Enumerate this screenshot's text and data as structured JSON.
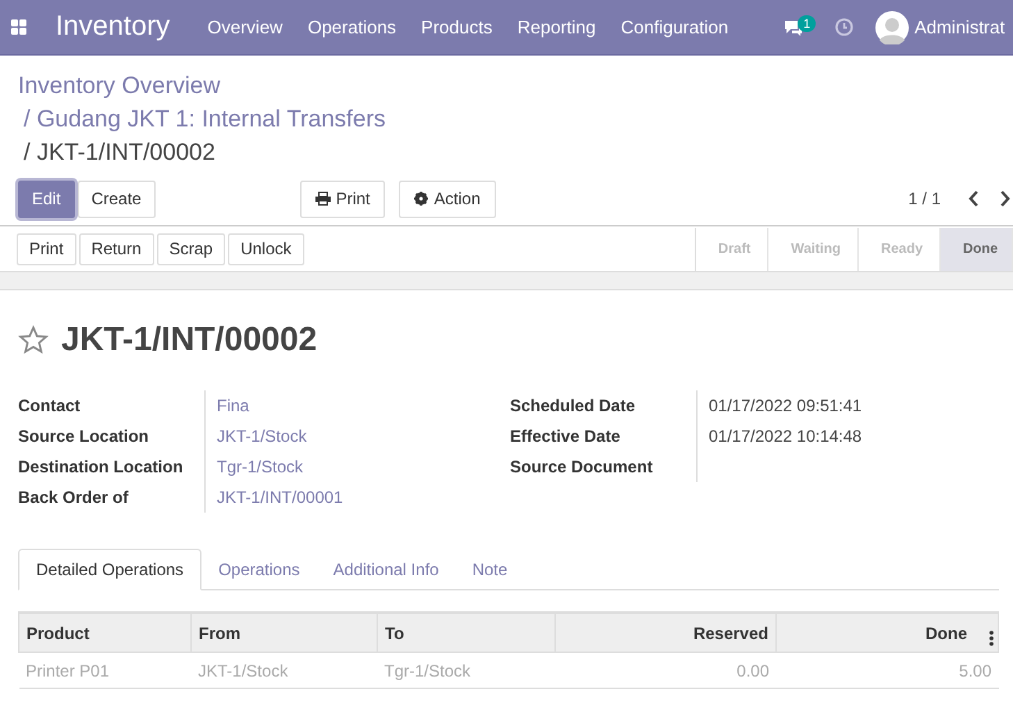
{
  "navbar": {
    "app_name": "Inventory",
    "menu": [
      "Overview",
      "Operations",
      "Products",
      "Reporting",
      "Configuration"
    ],
    "messages_count": "1",
    "user": "Administrat"
  },
  "breadcrumbs": [
    {
      "label": "Inventory Overview",
      "current": false
    },
    {
      "label": "/ Gudang JKT 1: Internal Transfers",
      "current": false
    },
    {
      "label": "/ JKT-1/INT/00002",
      "current": true
    }
  ],
  "control_buttons": [
    {
      "label": "Edit",
      "kind": "primary"
    },
    {
      "label": "Create",
      "kind": "plain"
    }
  ],
  "action_buttons": [
    {
      "label": "Print",
      "kind": "print"
    },
    {
      "label": "Action",
      "kind": "gear"
    }
  ],
  "pager": "1 / 1",
  "header_buttons": [
    "Print",
    "Return",
    "Scrap",
    "Unlock"
  ],
  "stages": [
    {
      "label": "Draft",
      "selected": false
    },
    {
      "label": "Waiting",
      "selected": false
    },
    {
      "label": "Ready",
      "selected": false
    },
    {
      "label": "Done",
      "selected": true
    }
  ],
  "record": {
    "starred": false,
    "title": "JKT-1/INT/00002"
  },
  "left_fields": [
    {
      "label": "Contact",
      "value": "Fina"
    },
    {
      "label": "Source Location",
      "value": "JKT-1/Stock"
    },
    {
      "label": "Destination Location",
      "value": "Tgr-1/Stock"
    },
    {
      "label": "Back Order of",
      "value": "JKT-1/INT/00001"
    }
  ],
  "right_fields": [
    {
      "label": "Scheduled Date",
      "value": "01/17/2022 09:51:41"
    },
    {
      "label": "Effective Date",
      "value": "01/17/2022 10:14:48"
    },
    {
      "label": "Source Document"
    }
  ],
  "tabs": [
    {
      "label": "Detailed Operations",
      "selected": true
    },
    {
      "label": "Operations",
      "selected": false
    },
    {
      "label": "Additional Info",
      "selected": false
    },
    {
      "label": "Note",
      "selected": false
    }
  ],
  "table": {
    "columns": [
      {
        "label": "Product",
        "numeric": false
      },
      {
        "label": "From",
        "numeric": false
      },
      {
        "label": "To",
        "numeric": false
      },
      {
        "label": "Reserved",
        "numeric": true
      },
      {
        "label": "Done",
        "numeric": true
      }
    ],
    "rows": [
      [
        "Printer P01",
        "JKT-1/Stock",
        "Tgr-1/Stock",
        "0.00",
        "5.00"
      ]
    ]
  }
}
